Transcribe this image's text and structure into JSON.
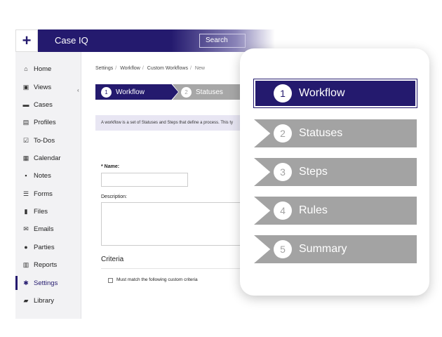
{
  "topbar": {
    "add_label": "+",
    "brand": "Case IQ",
    "search_label": "Search"
  },
  "sidebar": {
    "collapse_icon": "chevron-left-icon",
    "items": [
      {
        "label": "Home",
        "icon": "home-icon"
      },
      {
        "label": "Views",
        "icon": "views-icon"
      },
      {
        "label": "Cases",
        "icon": "folder-icon"
      },
      {
        "label": "Profiles",
        "icon": "profile-icon"
      },
      {
        "label": "To-Dos",
        "icon": "checkbox-icon"
      },
      {
        "label": "Calendar",
        "icon": "calendar-icon"
      },
      {
        "label": "Notes",
        "icon": "note-icon"
      },
      {
        "label": "Forms",
        "icon": "list-icon"
      },
      {
        "label": "Files",
        "icon": "file-icon"
      },
      {
        "label": "Emails",
        "icon": "email-icon"
      },
      {
        "label": "Parties",
        "icon": "person-icon"
      },
      {
        "label": "Reports",
        "icon": "report-icon"
      },
      {
        "label": "Settings",
        "icon": "gear-icon",
        "active": true
      },
      {
        "label": "Library",
        "icon": "book-icon"
      }
    ]
  },
  "breadcrumb": {
    "items": [
      "Settings",
      "Workflow",
      "Custom Workflows",
      "New"
    ]
  },
  "steps": [
    {
      "num": "1",
      "label": "Workflow"
    },
    {
      "num": "2",
      "label": "Statuses"
    }
  ],
  "form": {
    "info_text": "A workflow is a set of Statuses and Steps that define a process. This ty",
    "name_label": "* Name:",
    "name_value": "",
    "description_label": "Description:",
    "description_value": "",
    "criteria_heading": "Criteria",
    "criteria_checkbox_label": "Must match the following custom criteria"
  },
  "zoom_steps": [
    {
      "num": "1",
      "label": "Workflow",
      "active": true
    },
    {
      "num": "2",
      "label": "Statuses"
    },
    {
      "num": "3",
      "label": "Steps"
    },
    {
      "num": "4",
      "label": "Rules"
    },
    {
      "num": "5",
      "label": "Summary"
    }
  ],
  "colors": {
    "brand": "#241a6e",
    "inactive_step": "#a3a3a3",
    "info_bg": "#e8e6f3"
  }
}
